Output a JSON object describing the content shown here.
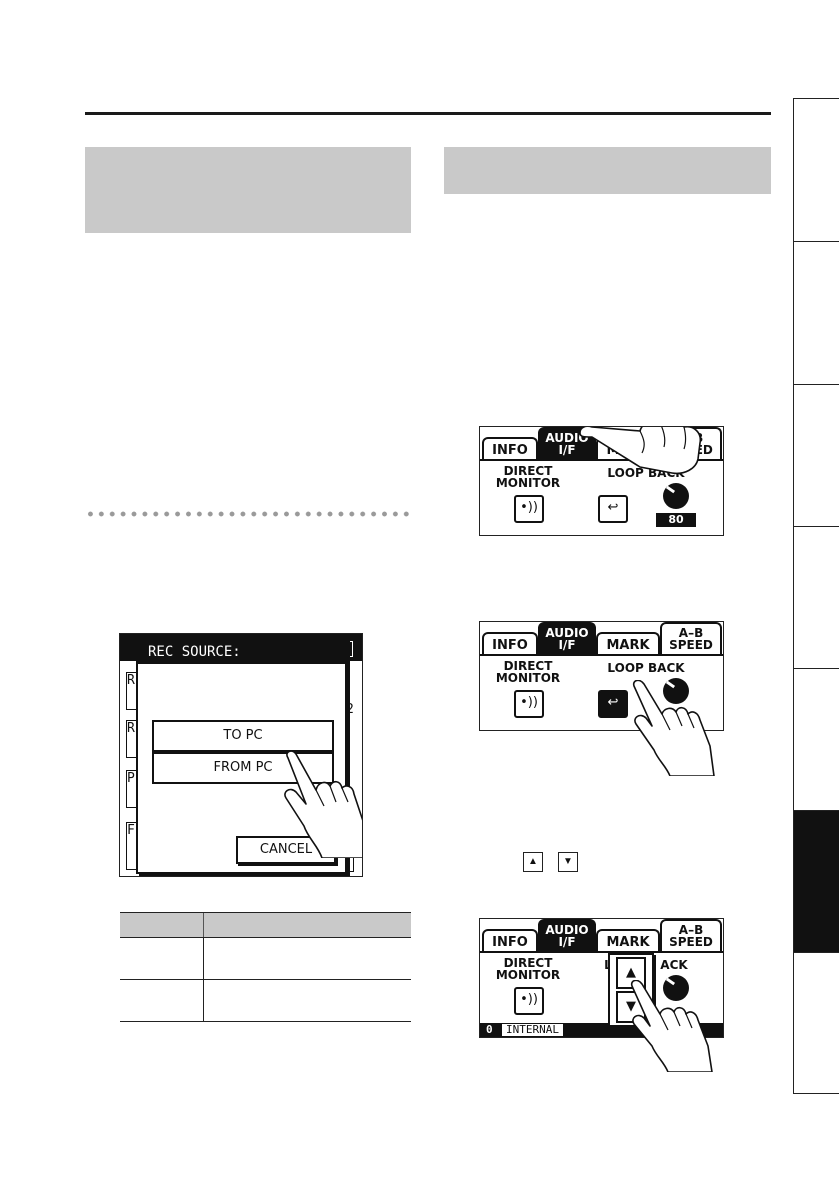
{
  "left_panel": {
    "dialog": {
      "title": "REC SOURCE:",
      "option_to_pc": "TO PC",
      "option_from_pc": "FROM PC",
      "cancel": "CANCEL",
      "bg_letters": [
        "R",
        "R",
        "P",
        "F"
      ],
      "bg_chars_right": ":",
      "bg_digit": "2"
    }
  },
  "screens": {
    "tab_info": "INFO",
    "tab_audio_1": "AUDIO",
    "tab_audio_2": "I/F",
    "tab_mark": "MARK",
    "tab_ab_1": "A–B",
    "tab_ab_2": "SPEED",
    "direct_monitor_1": "DIRECT",
    "direct_monitor_2": "MONITOR",
    "loop_back": "LOOP BACK",
    "knob_value": "80",
    "status_num": "0",
    "status_text": "INTERNAL",
    "mark_partial": "MARK",
    "loop_partial_1": "L",
    "loop_partial_2": "ACK"
  },
  "keys": {
    "up": "▲",
    "down": "▼"
  }
}
